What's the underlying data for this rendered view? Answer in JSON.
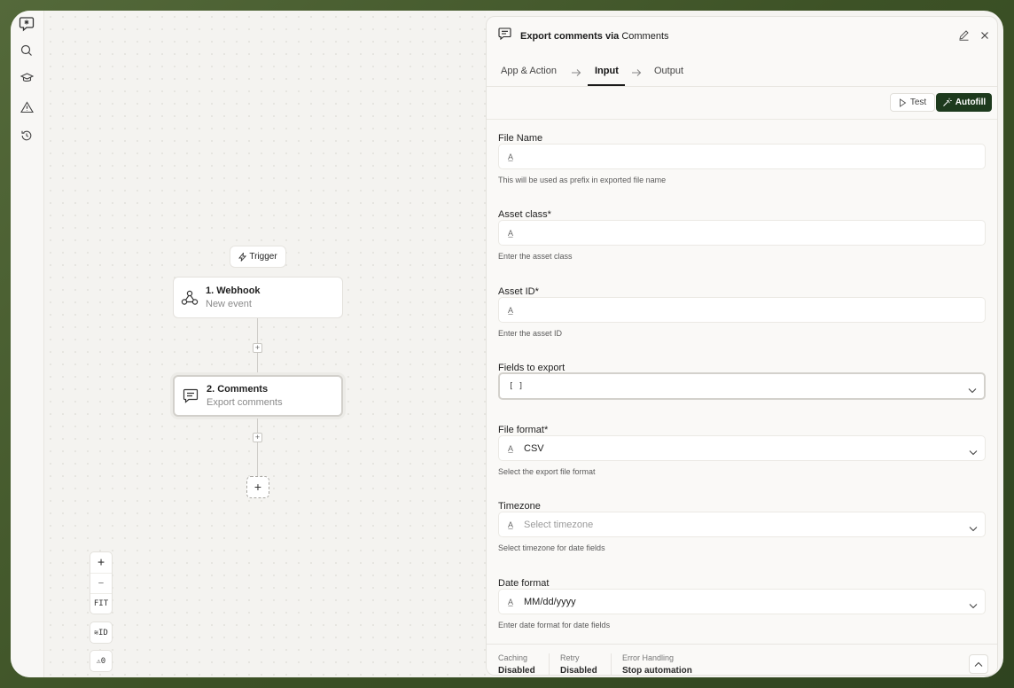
{
  "rail": {
    "icons": [
      "logo-icon",
      "search-icon",
      "academy-icon",
      "alert-icon",
      "history-icon"
    ]
  },
  "canvas": {
    "trigger_label": "Trigger",
    "nodes": [
      {
        "title": "1. Webhook",
        "subtitle": "New event",
        "icon": "webhook-icon"
      },
      {
        "title": "2. Comments",
        "subtitle": "Export comments",
        "icon": "comment-icon"
      }
    ],
    "add_step_label": "+",
    "zoom": {
      "in": "+",
      "out": "—",
      "fit": "FIT"
    },
    "id_toggle": "ID",
    "warnings_count": "0"
  },
  "panel": {
    "title_prefix": "Export comments via ",
    "title_app": "Comments",
    "tabs": [
      "App & Action",
      "Input",
      "Output"
    ],
    "active_tab": "Input",
    "test_label": "Test",
    "autofill_label": "Autofill",
    "fields": [
      {
        "label": "File Name",
        "value": "",
        "placeholder": "",
        "help": "This will be used as prefix in exported file name",
        "type": "text"
      },
      {
        "label": "Asset class*",
        "value": "",
        "placeholder": "",
        "help": "Enter the asset class",
        "type": "text"
      },
      {
        "label": "Asset ID*",
        "value": "",
        "placeholder": "",
        "help": "Enter the asset ID",
        "type": "text"
      },
      {
        "label": "Fields to export",
        "value": "[ ]",
        "placeholder": "",
        "help": "",
        "type": "array-select"
      },
      {
        "label": "File format*",
        "value": "CSV",
        "placeholder": "",
        "help": "Select the export file format",
        "type": "select"
      },
      {
        "label": "Timezone",
        "value": "",
        "placeholder": "Select timezone",
        "help": "Select timezone for date fields",
        "type": "select"
      },
      {
        "label": "Date format",
        "value": "MM/dd/yyyy",
        "placeholder": "",
        "help": "Enter date format for date fields",
        "type": "select"
      }
    ],
    "footer": {
      "caching_label": "Caching",
      "caching_value": "Disabled",
      "retry_label": "Retry",
      "retry_value": "Disabled",
      "error_label": "Error Handling",
      "error_value": "Stop automation"
    }
  },
  "colors": {
    "accent": "#1d3a1d",
    "frame": "#3d5226"
  }
}
